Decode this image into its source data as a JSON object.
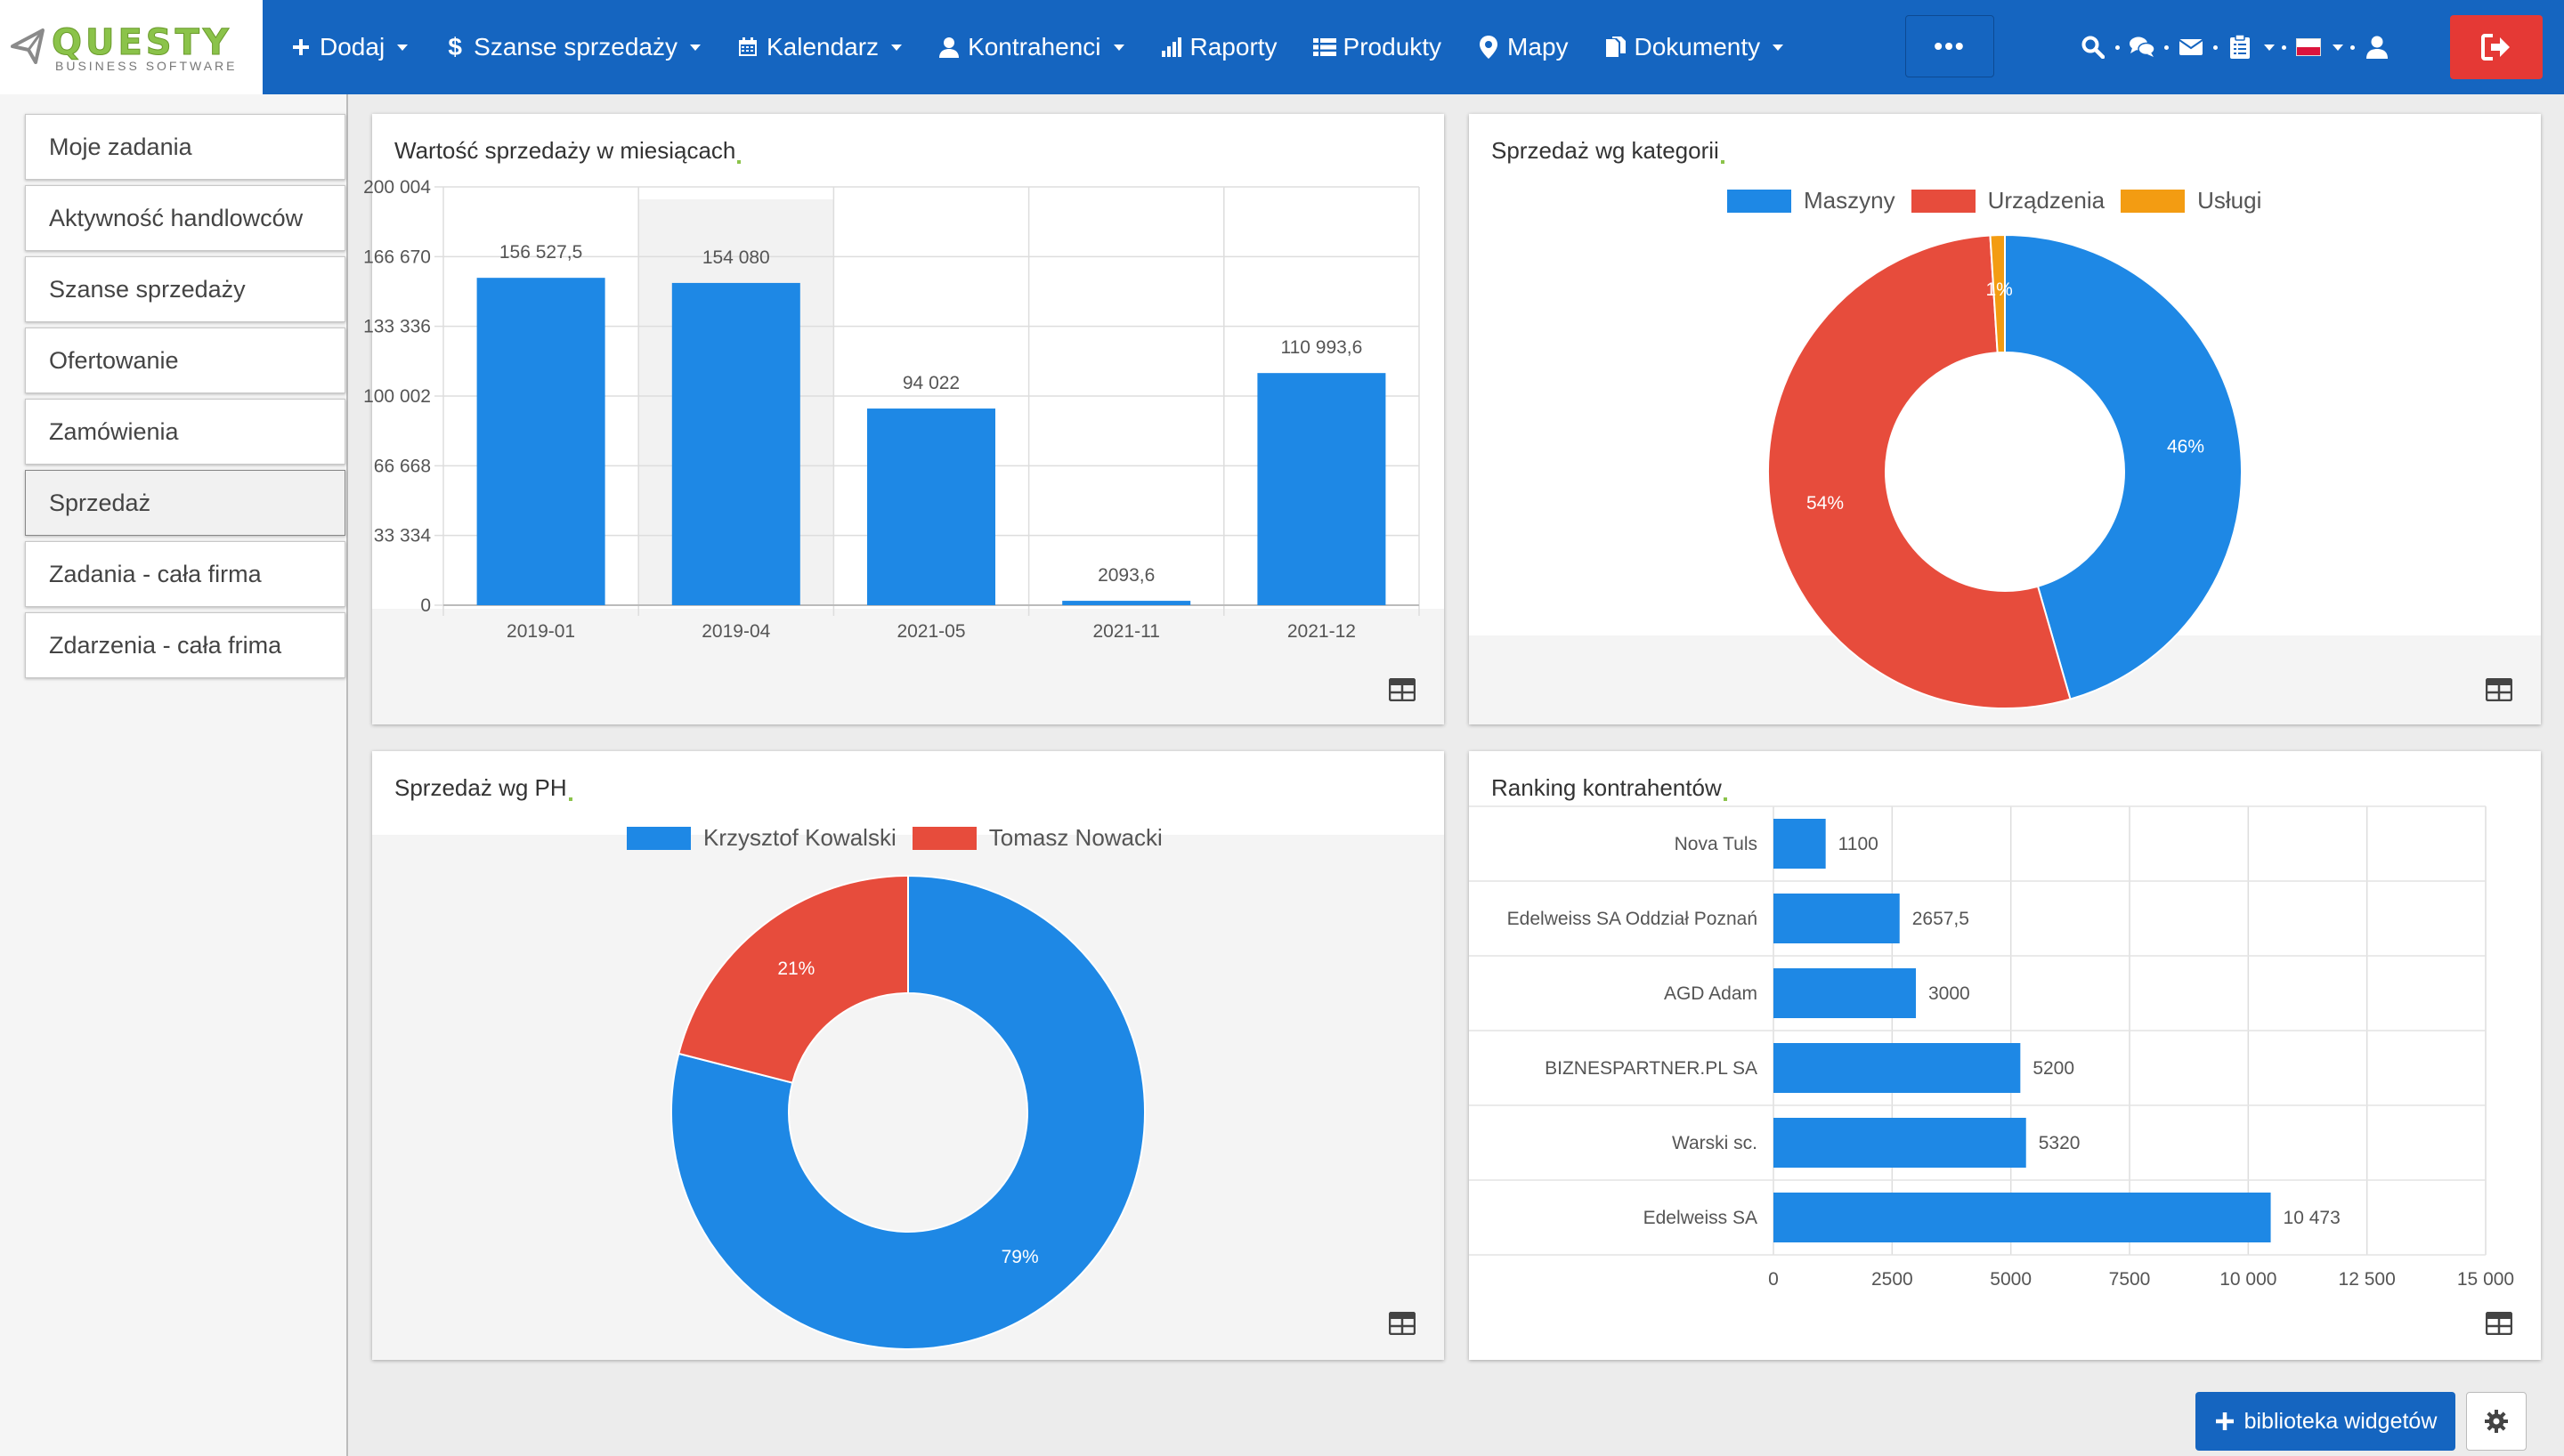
{
  "logo": {
    "name": "QUESTY",
    "subtitle": "BUSINESS SOFTWARE"
  },
  "nav": {
    "items": [
      {
        "label": "Dodaj",
        "icon": "plus-icon",
        "dropdown": true
      },
      {
        "label": "Szanse sprzedaży",
        "icon": "dollar-icon",
        "dropdown": true
      },
      {
        "label": "Kalendarz",
        "icon": "calendar-icon",
        "dropdown": true
      },
      {
        "label": "Kontrahenci",
        "icon": "user-icon",
        "dropdown": true
      },
      {
        "label": "Raporty",
        "icon": "bar-chart-icon",
        "dropdown": false
      },
      {
        "label": "Produkty",
        "icon": "list-icon",
        "dropdown": false
      },
      {
        "label": "Mapy",
        "icon": "map-marker-icon",
        "dropdown": false
      },
      {
        "label": "Dokumenty",
        "icon": "documents-icon",
        "dropdown": true
      }
    ],
    "more_label": "•••",
    "right_icons": [
      "search-icon",
      "chat-icon",
      "mail-icon",
      "clipboard-icon",
      "flag-icon",
      "user-icon"
    ]
  },
  "sidebar": {
    "items": [
      {
        "label": "Moje zadania",
        "active": false
      },
      {
        "label": "Aktywność handlowców",
        "active": false
      },
      {
        "label": "Szanse sprzedaży",
        "active": false
      },
      {
        "label": "Ofertowanie",
        "active": false
      },
      {
        "label": "Zamówienia",
        "active": false
      },
      {
        "label": "Sprzedaż",
        "active": true
      },
      {
        "label": "Zadania - cała firma",
        "active": false
      },
      {
        "label": "Zdarzenia - cała frima",
        "active": false
      }
    ]
  },
  "colors": {
    "navbar": "#1565c0",
    "blue": "#1e88e5",
    "red": "#e74c3c",
    "orange": "#f39c12",
    "logout": "#e53935",
    "logo_green": "#8bc34a"
  },
  "widgets": {
    "monthly": {
      "title": "Wartość sprzedaży w miesiącach"
    },
    "category": {
      "title": "Sprzedaż wg kategorii"
    },
    "ph": {
      "title": "Sprzedaż wg PH"
    },
    "ranking": {
      "title": "Ranking kontrahentów"
    }
  },
  "chart_data": [
    {
      "type": "bar",
      "title": "Wartość sprzedaży w miesiącach",
      "categories": [
        "2019-01",
        "2019-04",
        "2021-05",
        "2021-11",
        "2021-12"
      ],
      "values": [
        156527.5,
        154080,
        94022,
        2093.6,
        110993.6
      ],
      "value_labels": [
        "156 527,5",
        "154 080",
        "94 022",
        "2093,6",
        "110 993,6"
      ],
      "yticks": [
        "200 004",
        "166 670",
        "133 336",
        "100 002",
        "66 668",
        "33 334",
        "0"
      ],
      "ylim": [
        0,
        200004
      ],
      "color": "#1e88e5",
      "grid": true
    },
    {
      "type": "pie",
      "title": "Sprzedaż wg kategorii",
      "donut": true,
      "labels": [
        "Maszyny",
        "Urządzenia",
        "Usługi"
      ],
      "values": [
        46,
        54,
        1
      ],
      "percent_labels": [
        "46%",
        "54%",
        "1%"
      ],
      "colors": [
        "#1e88e5",
        "#e74c3c",
        "#f39c12"
      ],
      "legend": "top"
    },
    {
      "type": "pie",
      "title": "Sprzedaż wg PH",
      "donut": true,
      "labels": [
        "Krzysztof Kowalski",
        "Tomasz Nowacki"
      ],
      "values": [
        79,
        21
      ],
      "percent_labels": [
        "79%",
        "21%"
      ],
      "colors": [
        "#1e88e5",
        "#e74c3c"
      ],
      "legend": "top"
    },
    {
      "type": "bar",
      "orientation": "horizontal",
      "title": "Ranking kontrahentów",
      "categories": [
        "Nova Tuls",
        "Edelweiss SA Oddział Poznań",
        "AGD Adam",
        "BIZNESPARTNER.PL SA",
        "Warski sc.",
        "Edelweiss SA"
      ],
      "values": [
        1100,
        2657.5,
        3000,
        5200,
        5320,
        10473
      ],
      "value_labels": [
        "1100",
        "2657,5",
        "3000",
        "5200",
        "5320",
        "10 473"
      ],
      "xticks": [
        "0",
        "2500",
        "5000",
        "7500",
        "10 000",
        "12 500",
        "15 000"
      ],
      "xlim": [
        0,
        15000
      ],
      "color": "#1e88e5",
      "grid": true
    }
  ],
  "footer": {
    "widget_library_label": "biblioteka widgetów",
    "settings_icon": "gear-icon"
  }
}
